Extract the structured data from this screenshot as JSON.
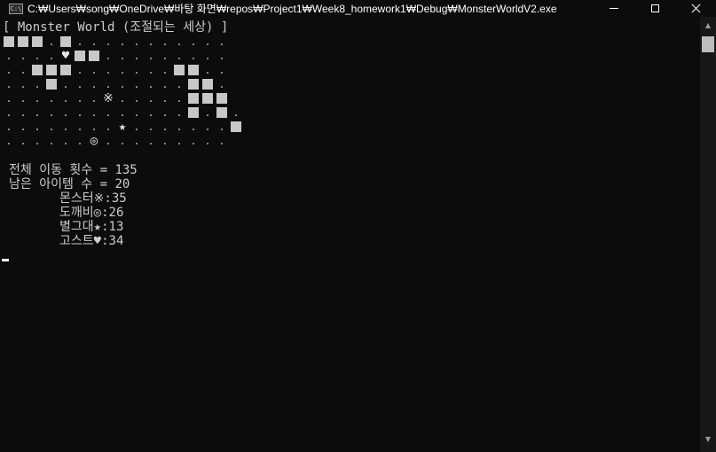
{
  "window": {
    "title": "C:₩Users₩song₩OneDrive₩바탕 화면₩repos₩Project1₩Week8_homework1₩Debug₩MonsterWorldV2.exe",
    "icon": "console-app-icon",
    "icon_text": "C:\\"
  },
  "console": {
    "header": "[ Monster World (조절되는 세상) ]",
    "map_legend": {
      "W": "wall-block",
      ".": "empty-dot",
      "M": "※",
      "D": "◎",
      "B": "★",
      "G": "♥"
    },
    "map": [
      "WWW.W...........",
      "....GWW.........",
      "..WWW.......WW..",
      "...W.........WW.",
      ".......M.....WWW",
      ".............W.W.",
      "........B.......W",
      "......D........."
    ],
    "total_moves_label": "전체 이동 횟수 = ",
    "total_moves": "135",
    "items_left_label": "남은 아이템 수 = ",
    "items_left": "20",
    "monsters": [
      {
        "name": "몬스터",
        "symbol": "※",
        "count": "35"
      },
      {
        "name": "도깨비",
        "symbol": "◎",
        "count": "26"
      },
      {
        "name": "별그대",
        "symbol": "★",
        "count": "13"
      },
      {
        "name": "고스트",
        "symbol": "♥",
        "count": "34"
      }
    ]
  }
}
